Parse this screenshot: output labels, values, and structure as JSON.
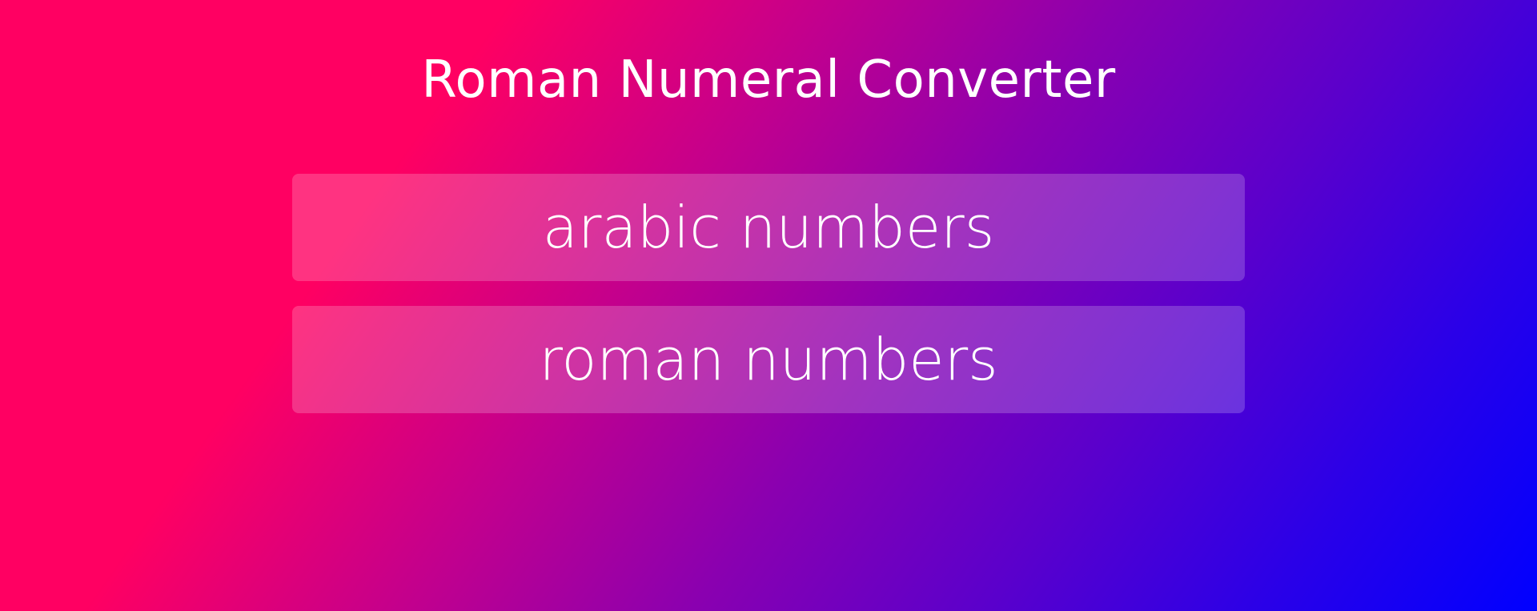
{
  "app": {
    "title": "Roman Numeral Converter"
  },
  "inputs": {
    "arabic": {
      "value": "",
      "placeholder": "arabic numbers"
    },
    "roman": {
      "value": "",
      "placeholder": "roman numbers"
    }
  },
  "colors": {
    "gradient_start": "#ff0062",
    "gradient_end": "#0000ff",
    "text": "#ffffff"
  }
}
